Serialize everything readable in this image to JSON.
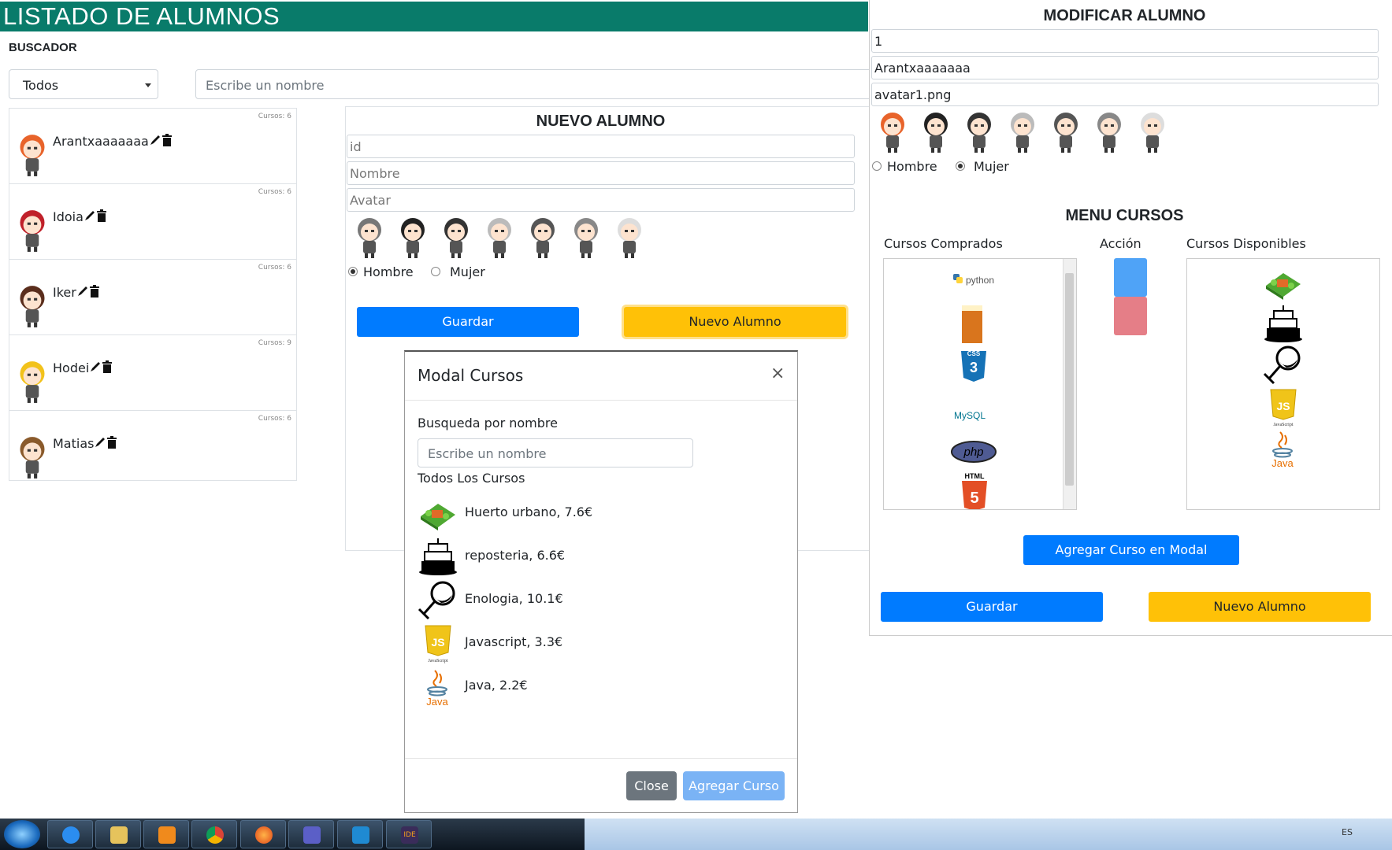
{
  "header": {
    "title": "LISTADO DE ALUMNOS"
  },
  "buscador": {
    "label": "BUSCADOR",
    "filter_value": "Todos",
    "search_placeholder": "Escribe un nombre"
  },
  "students": [
    {
      "name": "Arantxaaaaaaa",
      "courses": "Cursos: 6"
    },
    {
      "name": "Idoia",
      "courses": "Cursos: 6"
    },
    {
      "name": "Iker",
      "courses": "Cursos: 6"
    },
    {
      "name": "Hodei",
      "courses": "Cursos: 9"
    },
    {
      "name": "Matias",
      "courses": "Cursos: 6"
    }
  ],
  "nuevo": {
    "title": "NUEVO ALUMNO",
    "id_placeholder": "id",
    "nombre_placeholder": "Nombre",
    "avatar_placeholder": "Avatar",
    "gender": {
      "hombre": "Hombre",
      "mujer": "Mujer",
      "selected": "Hombre"
    },
    "save_label": "Guardar",
    "new_label": "Nuevo Alumno"
  },
  "modal": {
    "title": "Modal Cursos",
    "close_symbol": "×",
    "search_label": "Busqueda por nombre",
    "search_placeholder": "Escribe un nombre",
    "all_label": "Todos Los Cursos",
    "courses": [
      {
        "label": "Huerto urbano, 7.6€",
        "icon": "garden-icon"
      },
      {
        "label": "reposteria, 6.6€",
        "icon": "cake-icon"
      },
      {
        "label": "Enologia, 10.1€",
        "icon": "wine-glass-icon"
      },
      {
        "label": "Javascript, 3.3€",
        "icon": "javascript-icon"
      },
      {
        "label": "Java, 2.2€",
        "icon": "java-icon"
      }
    ],
    "close_label": "Close",
    "add_label": "Agregar Curso"
  },
  "modificar": {
    "title": "MODIFICAR ALUMNO",
    "id_value": "1",
    "nombre_value": "Arantxaaaaaaa",
    "avatar_value": "avatar1.png",
    "gender": {
      "hombre": "Hombre",
      "mujer": "Mujer",
      "selected": "Mujer"
    },
    "menu_title": "MENU CURSOS",
    "comprados_label": "Cursos Comprados",
    "accion_label": "Acción",
    "disponibles_label": "Cursos Disponibles",
    "comprados": [
      "python-icon",
      "beer-icon",
      "css3-icon",
      "mysql-icon",
      "php-icon",
      "html5-icon"
    ],
    "disponibles": [
      "garden-icon",
      "cake-icon",
      "wine-glass-icon",
      "javascript-icon",
      "java-icon"
    ],
    "modal_button_label": "Agregar Curso en Modal",
    "save_label": "Guardar",
    "new_label": "Nuevo Alumno"
  },
  "icon_text": {
    "python": "python",
    "css": "CSS",
    "mysql": "MySQL",
    "php": "php",
    "html": "HTML",
    "js": "JS",
    "javascript": "JavaScript",
    "java": "Java",
    "tb_ide": "IDE"
  },
  "taskbar": {
    "apps": [
      "windows-start-icon",
      "internet-explorer-icon",
      "file-explorer-icon",
      "media-player-icon",
      "chrome-icon",
      "firefox-icon",
      "teams-icon",
      "vscode-icon",
      "eclipse-ide-icon"
    ],
    "language": "ES"
  },
  "colors": {
    "header": "#097b6a",
    "primary": "#007bff",
    "warning": "#ffc107",
    "secondary": "#6c757d",
    "action_add": "#4fa3f7",
    "action_remove": "#e57e87"
  }
}
